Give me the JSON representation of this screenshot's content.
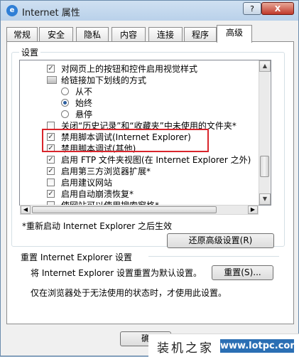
{
  "window": {
    "title": "Internet 属性",
    "help": "?",
    "close": "X",
    "icon": "ie-icon"
  },
  "tabs": [
    {
      "label": "常规"
    },
    {
      "label": "安全"
    },
    {
      "label": "隐私"
    },
    {
      "label": "内容"
    },
    {
      "label": "连接"
    },
    {
      "label": "程序"
    },
    {
      "label": "高级",
      "active": true
    }
  ],
  "settings": {
    "legend": "设置",
    "items": [
      {
        "type": "checkbox",
        "checked": true,
        "label": "对网页上的按钮和控件启用视觉样式"
      },
      {
        "type": "group",
        "label": "给链接加下划线的方式"
      },
      {
        "type": "radio",
        "checked": false,
        "label": "从不"
      },
      {
        "type": "radio",
        "checked": true,
        "label": "始终"
      },
      {
        "type": "radio",
        "checked": false,
        "label": "悬停"
      },
      {
        "type": "checkbox",
        "checked": false,
        "label": "关闭“历史记录”和“收藏夹”中未使用的文件夹*"
      },
      {
        "type": "checkbox",
        "checked": true,
        "label": "禁用脚本调试(Internet Explorer)"
      },
      {
        "type": "checkbox",
        "checked": true,
        "label": "禁用脚本调试(其他)"
      },
      {
        "type": "checkbox",
        "checked": true,
        "label": "启用 FTP 文件夹视图(在 Internet Explorer 之外)"
      },
      {
        "type": "checkbox",
        "checked": true,
        "label": "启用第三方浏览器扩展*"
      },
      {
        "type": "checkbox",
        "checked": false,
        "label": "启用建议网站"
      },
      {
        "type": "checkbox",
        "checked": true,
        "label": "启用自动崩溃恢复*"
      },
      {
        "type": "checkbox",
        "checked": false,
        "label": "使网站可以使用搜索窗格*"
      }
    ],
    "note": "*重新启动 Internet Explorer 之后生效",
    "restore_label": "还原高级设置(R)"
  },
  "reset": {
    "title": "重置 Internet Explorer 设置",
    "desc": "将 Internet Explorer 设置重置为默认设置。",
    "button": "重置(S)...",
    "note": "仅在浏览器处于无法使用的状态时，才使用此设置。"
  },
  "footer": {
    "ok_label": "确"
  },
  "watermark": {
    "cn": "装机之家",
    "url": "www.lotpc.com"
  }
}
